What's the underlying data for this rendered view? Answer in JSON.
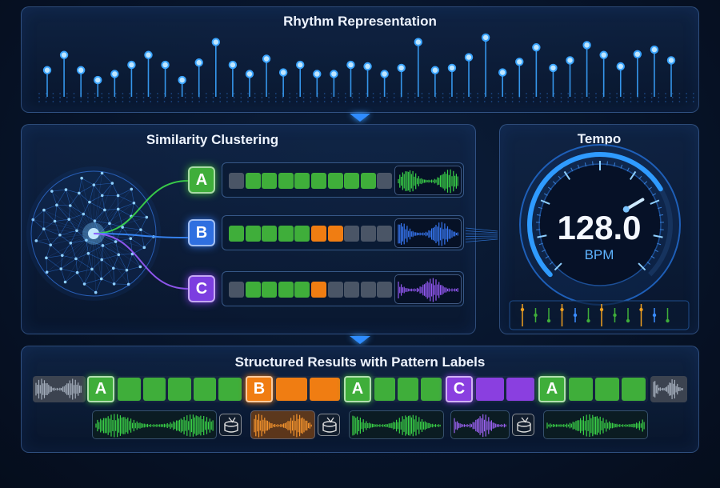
{
  "rhythm": {
    "title": "Rhythm Representation",
    "pulses": [
      0.35,
      0.55,
      0.35,
      0.22,
      0.3,
      0.42,
      0.55,
      0.42,
      0.22,
      0.45,
      0.72,
      0.42,
      0.3,
      0.5,
      0.32,
      0.42,
      0.3,
      0.3,
      0.42,
      0.4,
      0.3,
      0.38,
      0.72,
      0.35,
      0.38,
      0.52,
      0.78,
      0.32,
      0.46,
      0.65,
      0.38,
      0.48,
      0.68,
      0.55,
      0.4,
      0.56,
      0.62,
      0.48
    ]
  },
  "clustering": {
    "title": "Similarity Clustering",
    "clusters": [
      {
        "label": "A",
        "color": "#3fae3a",
        "cells": [
          "gray",
          "green",
          "green",
          "green",
          "green",
          "green",
          "green",
          "green",
          "green",
          "gray"
        ],
        "wave_color": "#3ddc4a"
      },
      {
        "label": "B",
        "color": "#2f6fe0",
        "cells": [
          "green",
          "green",
          "green",
          "green",
          "green",
          "orange",
          "orange",
          "gray",
          "gray",
          "gray"
        ],
        "wave_color": "#3a7dff"
      },
      {
        "label": "C",
        "color": "#7c3ee0",
        "cells": [
          "gray",
          "green",
          "green",
          "green",
          "green",
          "orange",
          "gray",
          "gray",
          "gray",
          "gray"
        ],
        "wave_color": "#9b5cff"
      }
    ]
  },
  "tempo": {
    "title": "Tempo",
    "value": "128.0",
    "unit": "BPM",
    "gauge_fraction": 0.72
  },
  "results": {
    "title": "Structured Results with Pattern Labels",
    "segments": [
      {
        "label": "A",
        "color": "#3fae3a",
        "cells": 5
      },
      {
        "label": "B",
        "color": "#f07d12",
        "cells": 2
      },
      {
        "label": "A",
        "color": "#3fae3a",
        "cells": 3
      },
      {
        "label": "C",
        "color": "#8a3fe0",
        "cells": 2
      },
      {
        "label": "A",
        "color": "#3fae3a",
        "cells": 3
      }
    ]
  },
  "colors": {
    "green": "#3fae3a",
    "orange": "#f07d12",
    "purple": "#8a3fe0",
    "blue": "#2f8cff",
    "gray": "#4a5566"
  }
}
